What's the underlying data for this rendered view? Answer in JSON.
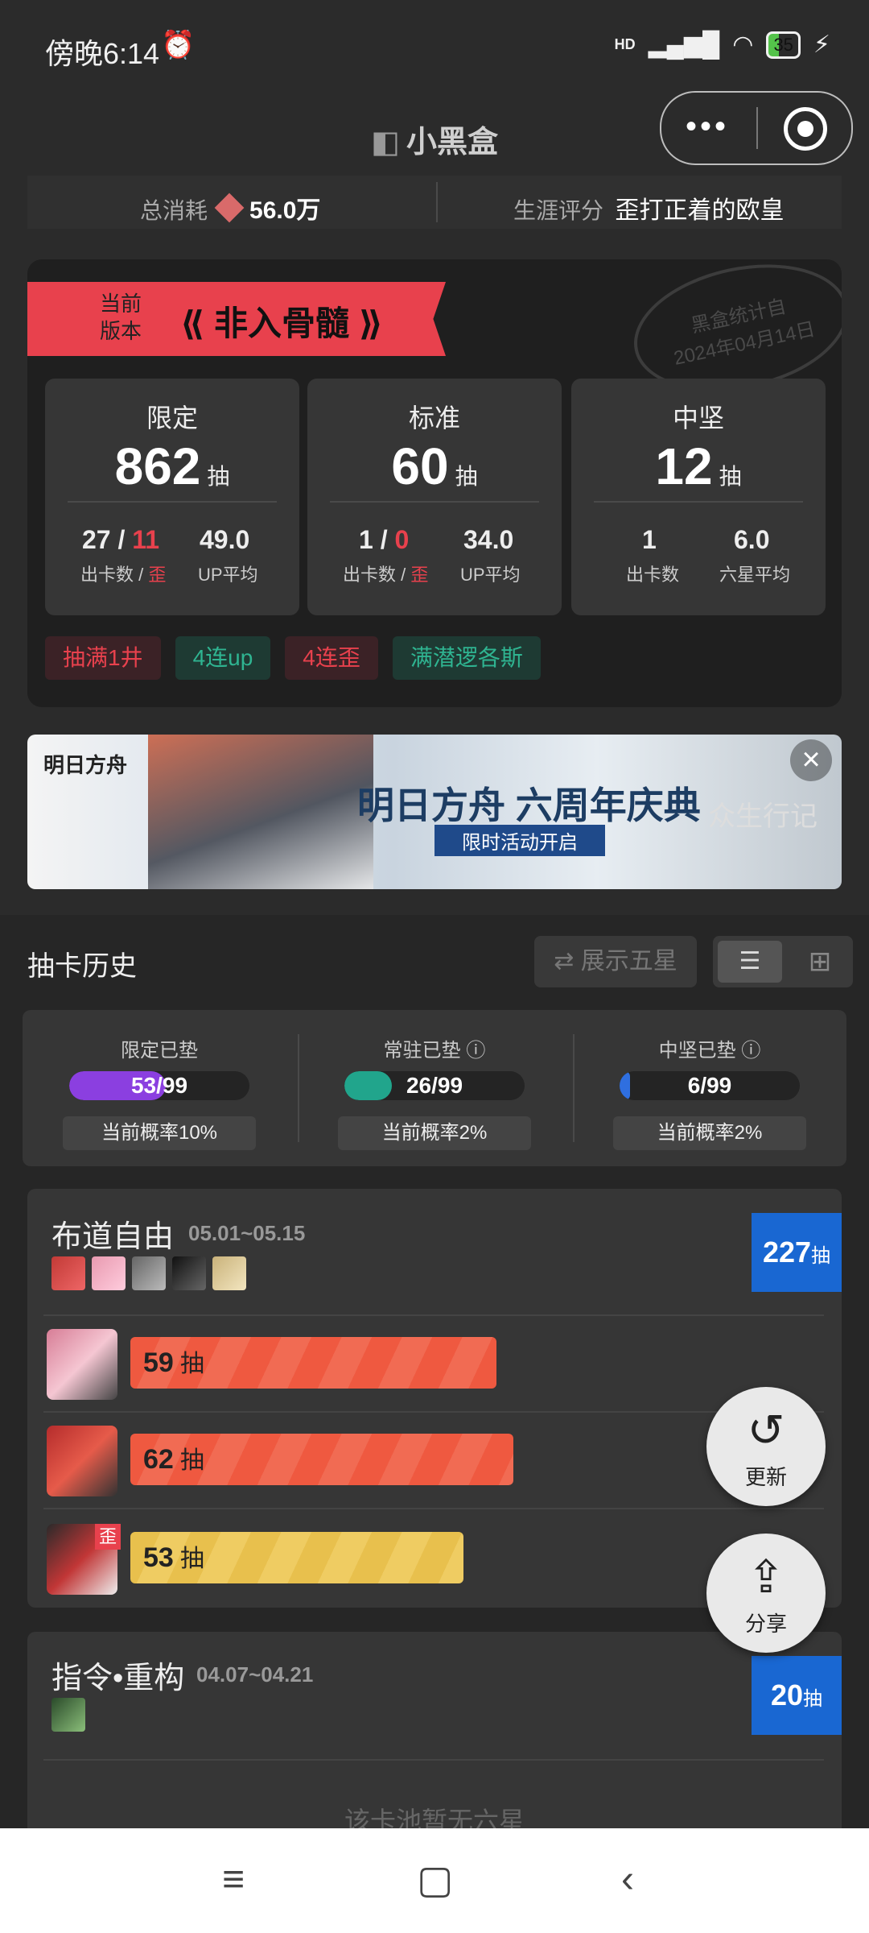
{
  "status_bar": {
    "time": "傍晚6:14",
    "alarm_icon": "alarm-icon",
    "hd": "HD",
    "battery": "35"
  },
  "titlebar": {
    "title": "小黑盒"
  },
  "summary": {
    "consume_label": "总消耗",
    "consume_value": "56.0万",
    "career_label": "生涯评分",
    "career_value": "歪打正着的欧皇"
  },
  "stats": {
    "ribbon_small_1": "当前",
    "ribbon_small_2": "版本",
    "ribbon_title": "非入骨髓",
    "stamp_line1": "黑盒统计自",
    "stamp_line2": "2024年04月14日",
    "pools": [
      {
        "name": "限定",
        "count": "862",
        "unit": "抽",
        "a_val": "27 / ",
        "a_red": "11",
        "a_lbl": "出卡数 / ",
        "a_lbl_red": "歪",
        "b_val": "49.0",
        "b_lbl": "UP平均"
      },
      {
        "name": "标准",
        "count": "60",
        "unit": "抽",
        "a_val": "1 / ",
        "a_red": "0",
        "a_lbl": "出卡数 / ",
        "a_lbl_red": "歪",
        "b_val": "34.0",
        "b_lbl": "UP平均"
      },
      {
        "name": "中坚",
        "count": "12",
        "unit": "抽",
        "a_val": "1",
        "a_red": "",
        "a_lbl": "出卡数",
        "a_lbl_red": "",
        "b_val": "6.0",
        "b_lbl": "六星平均"
      }
    ],
    "tags": [
      "抽满1井",
      "4连up",
      "4连歪",
      "满潜逻各斯"
    ]
  },
  "banner": {
    "logo": "明日方舟",
    "headline": "明日方舟 六周年庆典",
    "sub": "限时活动开启",
    "side": "众生行记"
  },
  "history": {
    "title": "抽卡历史",
    "five_star_label": "展示五星",
    "pity": [
      {
        "label": "限定已垫",
        "value": "53/99",
        "fraction": 0.535,
        "color": "#8b3fe0",
        "prob": "当前概率10%",
        "info": false
      },
      {
        "label": "常驻已垫",
        "value": "26/99",
        "fraction": 0.263,
        "color": "#21a58c",
        "prob": "当前概率2%",
        "info": true
      },
      {
        "label": "中坚已垫",
        "value": "6/99",
        "fraction": 0.06,
        "color": "#2f6fe0",
        "prob": "当前概率2%",
        "info": true
      }
    ]
  },
  "pool1": {
    "name": "布道自由",
    "dates": "05.01~05.15",
    "total": "227",
    "total_unit": "抽",
    "rows": [
      {
        "count": "59",
        "unit": "抽",
        "fraction": 0.66,
        "kind": "red",
        "wai": false
      },
      {
        "count": "62",
        "unit": "抽",
        "fraction": 0.69,
        "kind": "red",
        "wai": false
      },
      {
        "count": "53",
        "unit": "抽",
        "fraction": 0.6,
        "kind": "yellow",
        "wai": true,
        "wai_label": "歪"
      }
    ]
  },
  "pool2": {
    "name": "指令•重构",
    "dates": "04.07~04.21",
    "total": "20",
    "total_unit": "抽",
    "empty": "该卡池暂无六星"
  },
  "fabs": {
    "refresh": "更新",
    "share": "分享"
  }
}
